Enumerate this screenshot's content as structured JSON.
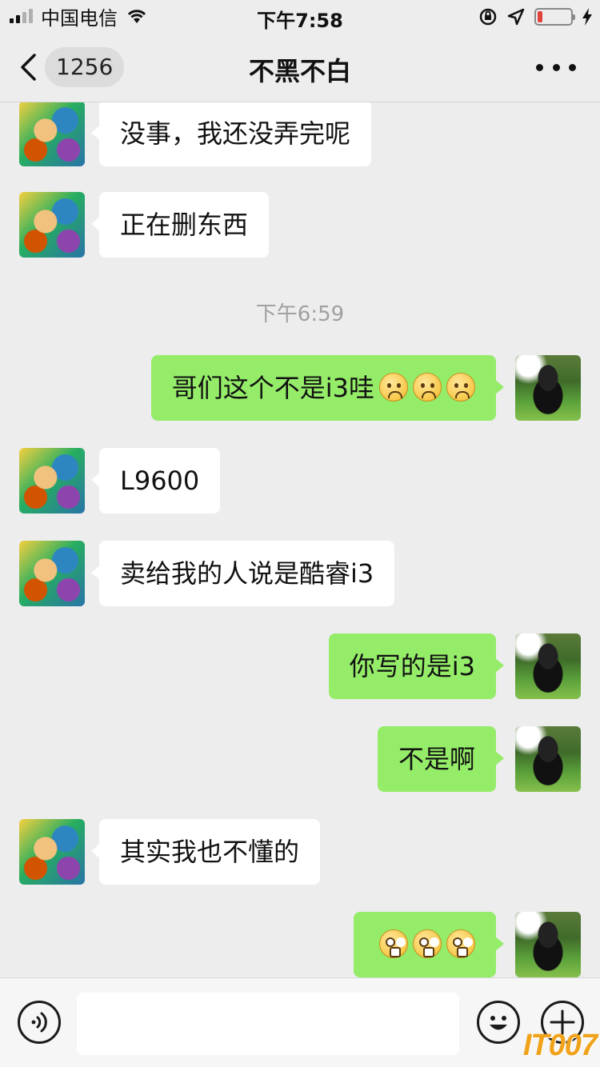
{
  "status_bar": {
    "carrier": "中国电信",
    "time": "下午7:58",
    "signal_bars": 4,
    "signal_bars_on": 2,
    "battery_level": 0.15,
    "battery_color": "#e0433b"
  },
  "nav": {
    "back_count": "1256",
    "title": "不黑不白"
  },
  "messages": [
    {
      "side": "left",
      "text": "没事，我还没弄完呢",
      "emojis": []
    },
    {
      "side": "left",
      "text": "正在删东西",
      "emojis": []
    },
    {
      "type": "timestamp",
      "text": "下午6:59"
    },
    {
      "side": "right",
      "text": "哥们这个不是i3哇",
      "emojis": [
        "sad",
        "sad",
        "sad"
      ]
    },
    {
      "side": "left",
      "text": "L9600",
      "emojis": []
    },
    {
      "side": "left",
      "text": "卖给我的人说是酷睿i3",
      "emojis": []
    },
    {
      "side": "right",
      "text": "你写的是i3",
      "emojis": []
    },
    {
      "side": "right",
      "text": "不是啊",
      "emojis": []
    },
    {
      "side": "left",
      "text": "其实我也不懂的",
      "emojis": []
    },
    {
      "side": "right",
      "text": "",
      "emojis": [
        "shock",
        "shock",
        "shock"
      ]
    }
  ],
  "input": {
    "value": "",
    "placeholder": ""
  },
  "icons": {
    "voice": "voice-icon",
    "emoji": "emoji-icon",
    "plus": "plus-icon"
  },
  "watermark": "IT007",
  "colors": {
    "outgoing_bubble": "#95ec69",
    "incoming_bubble": "#ffffff",
    "background": "#ededed"
  }
}
